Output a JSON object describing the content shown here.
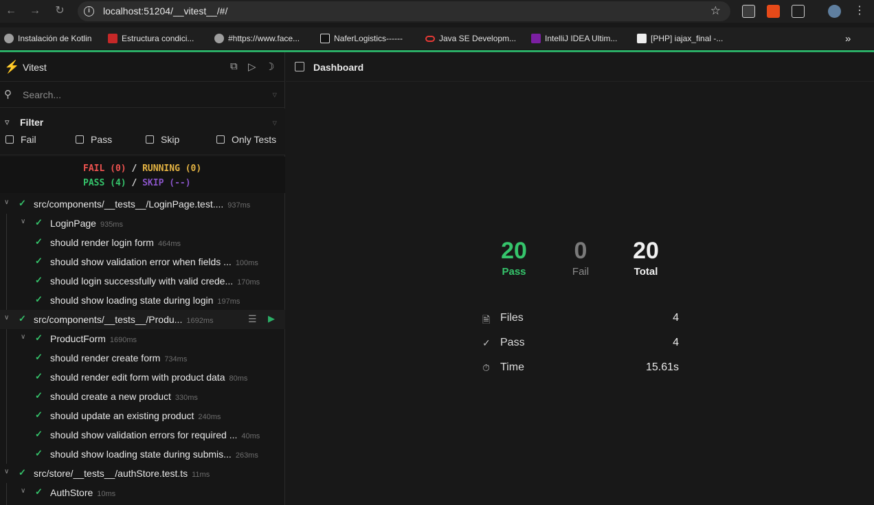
{
  "browser": {
    "url": "localhost:51204/__vitest__/#/",
    "bookmarks": [
      {
        "label": "Instalación de Kotlin",
        "icon": "globe-icon",
        "color": "#9e9e9e"
      },
      {
        "label": "Estructura condici...",
        "icon": "va-icon",
        "color": "#c62828"
      },
      {
        "label": "#https://www.face...",
        "icon": "globe-icon",
        "color": "#9e9e9e"
      },
      {
        "label": "NaferLogistics------",
        "icon": "angular-icon",
        "color": "#111111"
      },
      {
        "label": "Java SE Developm...",
        "icon": "oracle-icon",
        "color": "#e53935"
      },
      {
        "label": "IntelliJ IDEA Ultim...",
        "icon": "intellij-icon",
        "color": "#7b1fa2"
      },
      {
        "label": "[PHP] iajax_final -...",
        "icon": "php-icon",
        "color": "#eeeeee"
      }
    ]
  },
  "sidebar": {
    "brand": "Vitest",
    "search_placeholder": "Search...",
    "filter_title": "Filter",
    "filters": [
      "Fail",
      "Pass",
      "Skip",
      "Only Tests"
    ],
    "summary": {
      "fail": "FAIL (0)",
      "running": "RUNNING (0)",
      "pass": "PASS (4)",
      "skip": "SKIP (--)",
      "slash": "/"
    },
    "tree": [
      {
        "name": "src/components/__tests__/LoginPage.test....",
        "dur": "937ms"
      },
      {
        "name": "LoginPage",
        "dur": "935ms"
      },
      {
        "name": "should render login form",
        "dur": "464ms"
      },
      {
        "name": "should show validation error when fields ...",
        "dur": "100ms"
      },
      {
        "name": "should login successfully with valid crede...",
        "dur": "170ms"
      },
      {
        "name": "should show loading state during login",
        "dur": "197ms"
      },
      {
        "name": "src/components/__tests__/Produ...",
        "dur": "1692ms"
      },
      {
        "name": "ProductForm",
        "dur": "1690ms"
      },
      {
        "name": "should render create form",
        "dur": "734ms"
      },
      {
        "name": "should render edit form with product data",
        "dur": "80ms"
      },
      {
        "name": "should create a new product",
        "dur": "330ms"
      },
      {
        "name": "should update an existing product",
        "dur": "240ms"
      },
      {
        "name": "should show validation errors for required ...",
        "dur": "40ms"
      },
      {
        "name": "should show loading state during submis...",
        "dur": "263ms"
      },
      {
        "name": "src/store/__tests__/authStore.test.ts",
        "dur": "11ms"
      },
      {
        "name": "AuthStore",
        "dur": "10ms"
      }
    ]
  },
  "main": {
    "title": "Dashboard",
    "stats": {
      "pass_num": "20",
      "pass_label": "Pass",
      "fail_num": "0",
      "fail_label": "Fail",
      "total_num": "20",
      "total_label": "Total"
    },
    "details": {
      "files_label": "Files",
      "files_value": "4",
      "pass_label": "Pass",
      "pass_value": "4",
      "time_label": "Time",
      "time_value": "15.61s"
    }
  }
}
